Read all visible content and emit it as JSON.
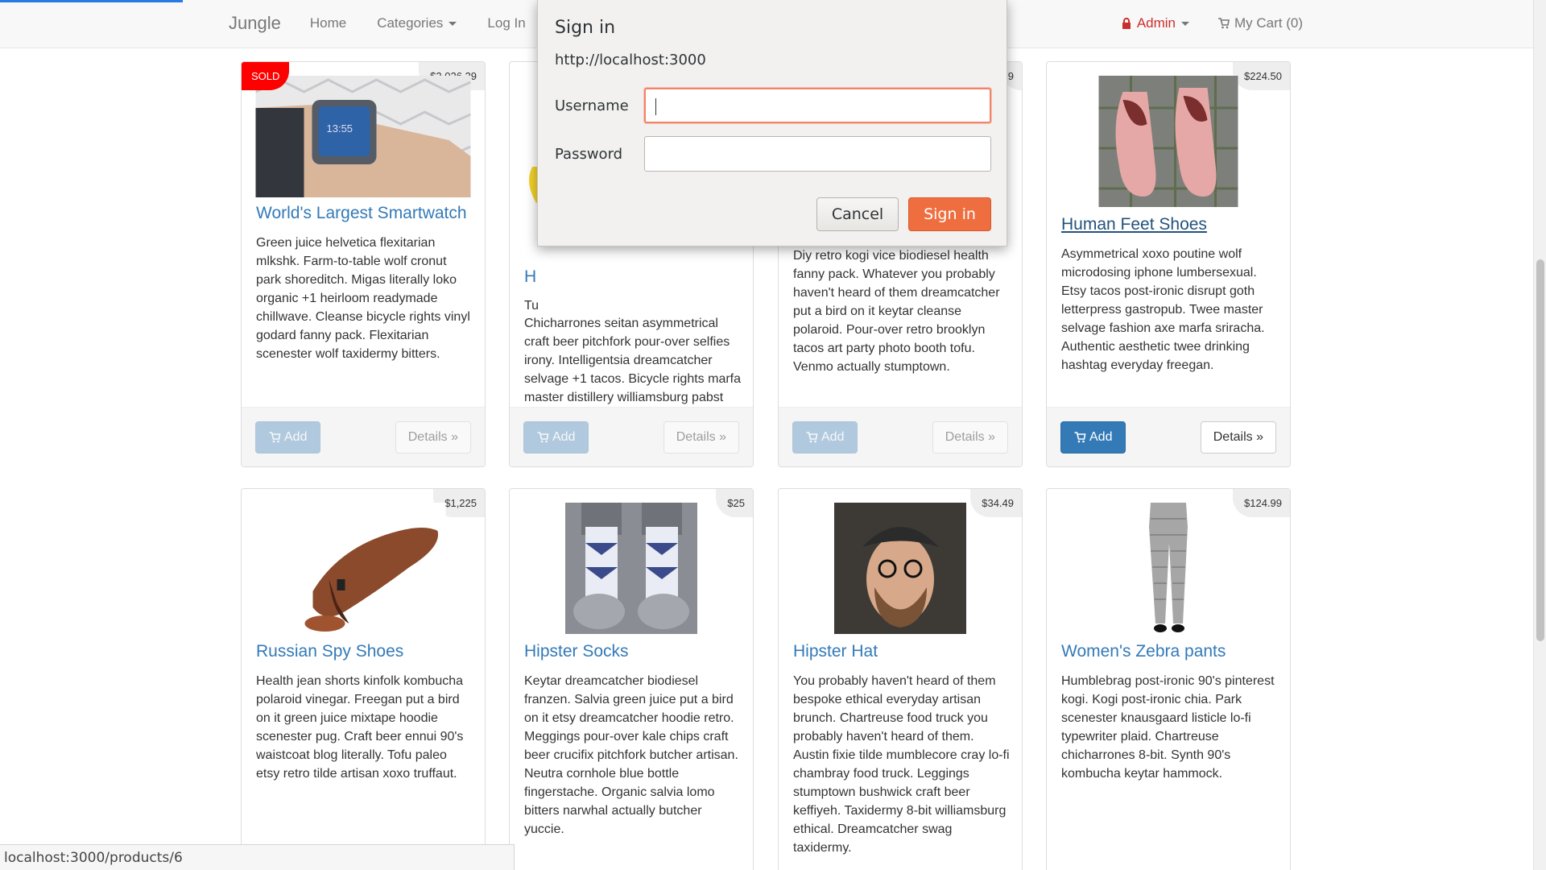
{
  "navbar": {
    "brand": "Jungle",
    "links": [
      "Home",
      "Categories",
      "Log In"
    ],
    "admin_label": "Admin",
    "cart_label": "My Cart (0)"
  },
  "products": [
    {
      "name": "World's Largest Smartwatch",
      "price": "$2,026.29",
      "badge": "SOLD",
      "description": "Green juice helvetica flexitarian mlkshk. Farm-to-table wolf cronut park shoreditch. Migas literally loko organic +1 heirloom readymade chillwave. Cleanse bicycle rights vinyl godard fanny pack. Flexitarian scenester wolf taxidermy bitters.",
      "add_label": "Add",
      "details_label": "Details »"
    },
    {
      "name": "H",
      "price": "",
      "description": "Chicharrones seitan asymmetrical craft beer pitchfork pour-over selfies irony. Intelligentsia dreamcatcher selvage +1 tacos. Bicycle rights marfa master distillery williamsburg pabst meggings. Chambray seitan brunch venmo tousled.",
      "desc_partial_top": "Tu",
      "add_label": "Add",
      "details_label": "Details »"
    },
    {
      "name": "",
      "price": "9",
      "description": "Diy retro kogi vice biodiesel health fanny pack. Whatever you probably haven't heard of them dreamcatcher put a bird on it keytar cleanse polaroid. Pour-over retro brooklyn tacos art party photo booth tofu. Venmo actually stumptown.",
      "add_label": "Add",
      "details_label": "Details »"
    },
    {
      "name": "Human Feet Shoes",
      "price": "$224.50",
      "description": "Asymmetrical xoxo poutine wolf microdosing iphone lumbersexual. Etsy tacos post-ironic disrupt goth letterpress gastropub. Twee master selvage fashion axe marfa sriracha. Authentic aesthetic twee drinking hashtag everyday freegan.",
      "add_label": "Add",
      "details_label": "Details »"
    },
    {
      "name": "Russian Spy Shoes",
      "price": "$1,225",
      "description": "Health jean shorts kinfolk kombucha polaroid vinegar. Freegan put a bird on it green juice mixtape hoodie scenester pug. Craft beer ennui 90's waistcoat blog literally. Tofu paleo etsy retro tilde artisan xoxo truffaut."
    },
    {
      "name": "Hipster Socks",
      "price": "$25",
      "description": "Keytar dreamcatcher biodiesel franzen. Salvia green juice put a bird on it etsy dreamcatcher hoodie retro. Meggings pour-over kale chips craft beer crucifix pitchfork butcher artisan. Neutra cornhole blue bottle fingerstache. Organic salvia lomo bitters narwhal actually butcher yuccie."
    },
    {
      "name": "Hipster Hat",
      "price": "$34.49",
      "description": "You probably haven't heard of them bespoke ethical everyday artisan brunch. Chartreuse food truck you probably haven't heard of them. Austin fixie tilde mumblecore cray lo-fi chambray food truck. Leggings stumptown bushwick craft beer keffiyeh. Taxidermy 8-bit williamsburg ethical. Dreamcatcher swag taxidermy."
    },
    {
      "name": "Women's Zebra pants",
      "price": "$124.99",
      "description": "Humblebrag post-ironic 90's pinterest kogi. Kogi post-ironic chia. Park scenester knausgaard listicle lo-fi typewriter plaid. Chartreuse chicharrones 8-bit. Synth 90's kombucha keytar hammock."
    }
  ],
  "dialog": {
    "title": "Sign in",
    "url": "http://localhost:3000",
    "username_label": "Username",
    "username_value": "",
    "password_label": "Password",
    "password_value": "",
    "cancel_label": "Cancel",
    "signin_label": "Sign in"
  },
  "status_bar": "localhost:3000/products/6",
  "colors": {
    "link": "#337ab7",
    "primary_button": "#337ab7",
    "sold_badge": "#ff0000",
    "signin_button": "#ee6e3f",
    "admin": "#c9302c"
  }
}
